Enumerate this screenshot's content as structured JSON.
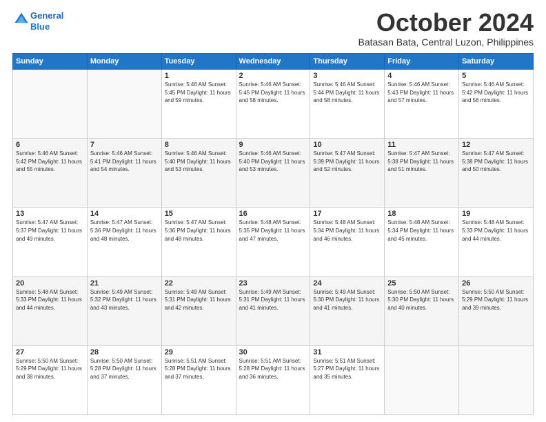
{
  "header": {
    "logo_line1": "General",
    "logo_line2": "Blue",
    "month": "October 2024",
    "location": "Batasan Bata, Central Luzon, Philippines"
  },
  "weekdays": [
    "Sunday",
    "Monday",
    "Tuesday",
    "Wednesday",
    "Thursday",
    "Friday",
    "Saturday"
  ],
  "weeks": [
    [
      {
        "day": "",
        "info": ""
      },
      {
        "day": "",
        "info": ""
      },
      {
        "day": "1",
        "info": "Sunrise: 5:46 AM\nSunset: 5:45 PM\nDaylight: 11 hours\nand 59 minutes."
      },
      {
        "day": "2",
        "info": "Sunrise: 5:46 AM\nSunset: 5:45 PM\nDaylight: 11 hours\nand 58 minutes."
      },
      {
        "day": "3",
        "info": "Sunrise: 5:46 AM\nSunset: 5:44 PM\nDaylight: 11 hours\nand 58 minutes."
      },
      {
        "day": "4",
        "info": "Sunrise: 5:46 AM\nSunset: 5:43 PM\nDaylight: 11 hours\nand 57 minutes."
      },
      {
        "day": "5",
        "info": "Sunrise: 5:46 AM\nSunset: 5:42 PM\nDaylight: 11 hours\nand 56 minutes."
      }
    ],
    [
      {
        "day": "6",
        "info": "Sunrise: 5:46 AM\nSunset: 5:42 PM\nDaylight: 11 hours\nand 55 minutes."
      },
      {
        "day": "7",
        "info": "Sunrise: 5:46 AM\nSunset: 5:41 PM\nDaylight: 11 hours\nand 54 minutes."
      },
      {
        "day": "8",
        "info": "Sunrise: 5:46 AM\nSunset: 5:40 PM\nDaylight: 11 hours\nand 53 minutes."
      },
      {
        "day": "9",
        "info": "Sunrise: 5:46 AM\nSunset: 5:40 PM\nDaylight: 11 hours\nand 53 minutes."
      },
      {
        "day": "10",
        "info": "Sunrise: 5:47 AM\nSunset: 5:39 PM\nDaylight: 11 hours\nand 52 minutes."
      },
      {
        "day": "11",
        "info": "Sunrise: 5:47 AM\nSunset: 5:38 PM\nDaylight: 11 hours\nand 51 minutes."
      },
      {
        "day": "12",
        "info": "Sunrise: 5:47 AM\nSunset: 5:38 PM\nDaylight: 11 hours\nand 50 minutes."
      }
    ],
    [
      {
        "day": "13",
        "info": "Sunrise: 5:47 AM\nSunset: 5:37 PM\nDaylight: 11 hours\nand 49 minutes."
      },
      {
        "day": "14",
        "info": "Sunrise: 5:47 AM\nSunset: 5:36 PM\nDaylight: 11 hours\nand 48 minutes."
      },
      {
        "day": "15",
        "info": "Sunrise: 5:47 AM\nSunset: 5:36 PM\nDaylight: 11 hours\nand 48 minutes."
      },
      {
        "day": "16",
        "info": "Sunrise: 5:48 AM\nSunset: 5:35 PM\nDaylight: 11 hours\nand 47 minutes."
      },
      {
        "day": "17",
        "info": "Sunrise: 5:48 AM\nSunset: 5:34 PM\nDaylight: 11 hours\nand 46 minutes."
      },
      {
        "day": "18",
        "info": "Sunrise: 5:48 AM\nSunset: 5:34 PM\nDaylight: 11 hours\nand 45 minutes."
      },
      {
        "day": "19",
        "info": "Sunrise: 5:48 AM\nSunset: 5:33 PM\nDaylight: 11 hours\nand 44 minutes."
      }
    ],
    [
      {
        "day": "20",
        "info": "Sunrise: 5:48 AM\nSunset: 5:33 PM\nDaylight: 11 hours\nand 44 minutes."
      },
      {
        "day": "21",
        "info": "Sunrise: 5:49 AM\nSunset: 5:32 PM\nDaylight: 11 hours\nand 43 minutes."
      },
      {
        "day": "22",
        "info": "Sunrise: 5:49 AM\nSunset: 5:31 PM\nDaylight: 11 hours\nand 42 minutes."
      },
      {
        "day": "23",
        "info": "Sunrise: 5:49 AM\nSunset: 5:31 PM\nDaylight: 11 hours\nand 41 minutes."
      },
      {
        "day": "24",
        "info": "Sunrise: 5:49 AM\nSunset: 5:30 PM\nDaylight: 11 hours\nand 41 minutes."
      },
      {
        "day": "25",
        "info": "Sunrise: 5:50 AM\nSunset: 5:30 PM\nDaylight: 11 hours\nand 40 minutes."
      },
      {
        "day": "26",
        "info": "Sunrise: 5:50 AM\nSunset: 5:29 PM\nDaylight: 11 hours\nand 39 minutes."
      }
    ],
    [
      {
        "day": "27",
        "info": "Sunrise: 5:50 AM\nSunset: 5:29 PM\nDaylight: 11 hours\nand 38 minutes."
      },
      {
        "day": "28",
        "info": "Sunrise: 5:50 AM\nSunset: 5:28 PM\nDaylight: 11 hours\nand 37 minutes."
      },
      {
        "day": "29",
        "info": "Sunrise: 5:51 AM\nSunset: 5:28 PM\nDaylight: 11 hours\nand 37 minutes."
      },
      {
        "day": "30",
        "info": "Sunrise: 5:51 AM\nSunset: 5:28 PM\nDaylight: 11 hours\nand 36 minutes."
      },
      {
        "day": "31",
        "info": "Sunrise: 5:51 AM\nSunset: 5:27 PM\nDaylight: 11 hours\nand 35 minutes."
      },
      {
        "day": "",
        "info": ""
      },
      {
        "day": "",
        "info": ""
      }
    ]
  ]
}
